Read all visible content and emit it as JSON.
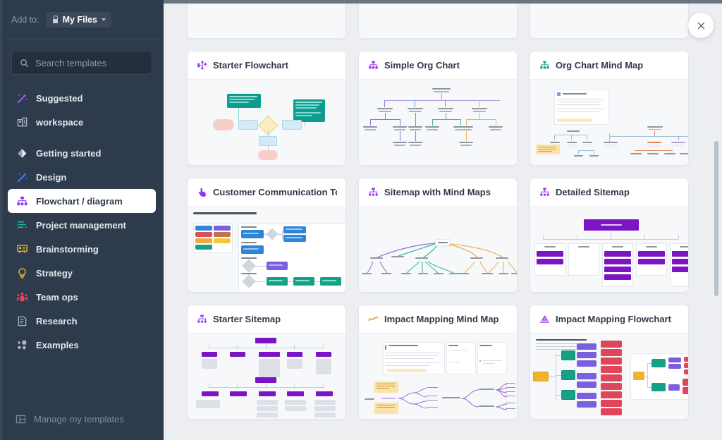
{
  "sidebar": {
    "add_to": {
      "label": "Add to:",
      "value": "My Files",
      "lock_icon": "lock-icon",
      "caret_icon": "chevron-down-icon"
    },
    "search": {
      "placeholder": "Search templates",
      "value": "",
      "icon": "search-icon"
    },
    "items": [
      {
        "label": "Suggested",
        "icon": "magic-wand-icon",
        "color": "#a855f7",
        "active": false,
        "gap_after": false
      },
      {
        "label": "workspace",
        "icon": "building-icon",
        "color": "#aeb8c4",
        "active": false,
        "gap_after": true
      },
      {
        "label": "Getting started",
        "icon": "diamond-icon",
        "color": "#e8ecf1",
        "active": false,
        "gap_after": false
      },
      {
        "label": "Design",
        "icon": "design-wand-icon",
        "color": "#3b82f6",
        "active": false,
        "gap_after": false
      },
      {
        "label": "Flowchart / diagram",
        "icon": "org-chart-icon",
        "color": "#9333ea",
        "active": true,
        "gap_after": false
      },
      {
        "label": "Project management",
        "icon": "gantt-icon",
        "color": "#14b8a6",
        "active": false,
        "gap_after": false
      },
      {
        "label": "Brainstorming",
        "icon": "whiteboard-icon",
        "color": "#f0b429",
        "active": false,
        "gap_after": false
      },
      {
        "label": "Strategy",
        "icon": "lightbulb-icon",
        "color": "#f0b429",
        "active": false,
        "gap_after": false
      },
      {
        "label": "Team ops",
        "icon": "people-icon",
        "color": "#ef4458",
        "active": false,
        "gap_after": false
      },
      {
        "label": "Research",
        "icon": "document-icon",
        "color": "#aeb8c4",
        "active": false,
        "gap_after": false
      },
      {
        "label": "Examples",
        "icon": "shapes-icon",
        "color": "#aeb8c4",
        "active": false,
        "gap_after": false
      }
    ],
    "footer": {
      "label": "Manage my templates",
      "icon": "layout-panels-icon"
    }
  },
  "main": {
    "close_button": {
      "icon": "close-icon",
      "label": "✕"
    },
    "scrollbar": {
      "name": "vertical-scrollbar"
    },
    "cards": [
      {
        "title": "",
        "icon": "flowchart-icon",
        "icon_color": "#9333ea",
        "thumb": "flow-purple-blue",
        "partial": true
      },
      {
        "title": "",
        "icon": "funnel-icon",
        "icon_color": "#9333ea",
        "thumb": "funnel",
        "partial": true
      },
      {
        "title": "",
        "icon": "mindmap-icon",
        "icon_color": "#9333ea",
        "thumb": "mindmap-wide",
        "partial": true
      },
      {
        "title": "Starter Flowchart",
        "icon": "flowchart-icon",
        "icon_color": "#9333ea",
        "thumb": "starter-flowchart",
        "partial": false
      },
      {
        "title": "Simple Org Chart",
        "icon": "org-chart-icon",
        "icon_color": "#9333ea",
        "thumb": "simple-org-chart",
        "partial": false
      },
      {
        "title": "Org Chart Mind Map",
        "icon": "org-chart-icon",
        "icon_color": "#1f9d8f",
        "thumb": "org-chart-mindmap",
        "partial": false
      },
      {
        "title": "Customer Communication Touchpoints",
        "icon": "pointer-hand-icon",
        "icon_color": "#9333ea",
        "thumb": "customer-comm",
        "partial": false
      },
      {
        "title": "Sitemap with Mind Maps",
        "icon": "sitemap-icon",
        "icon_color": "#9333ea",
        "thumb": "sitemap-mindmap",
        "partial": false
      },
      {
        "title": "Detailed Sitemap",
        "icon": "sitemap-icon",
        "icon_color": "#9333ea",
        "thumb": "detailed-sitemap",
        "partial": false
      },
      {
        "title": "Starter Sitemap",
        "icon": "sitemap-icon",
        "icon_color": "#9333ea",
        "thumb": "starter-sitemap",
        "partial": false
      },
      {
        "title": "Impact Mapping Mind Map",
        "icon": "trend-line-icon",
        "icon_color": "#f0972a",
        "thumb": "impact-mindmap",
        "partial": false
      },
      {
        "title": "Impact Mapping Flowchart",
        "icon": "impact-icon",
        "icon_color": "#9333ea",
        "thumb": "impact-flowchart",
        "partial": false
      }
    ]
  },
  "colors": {
    "sidebar_bg": "#2d3b4c",
    "main_bg": "#eceef2",
    "card_bg": "#ffffff",
    "accent_purple": "#9333ea",
    "accent_teal": "#1f9d8f",
    "accent_orange": "#f0972a"
  }
}
